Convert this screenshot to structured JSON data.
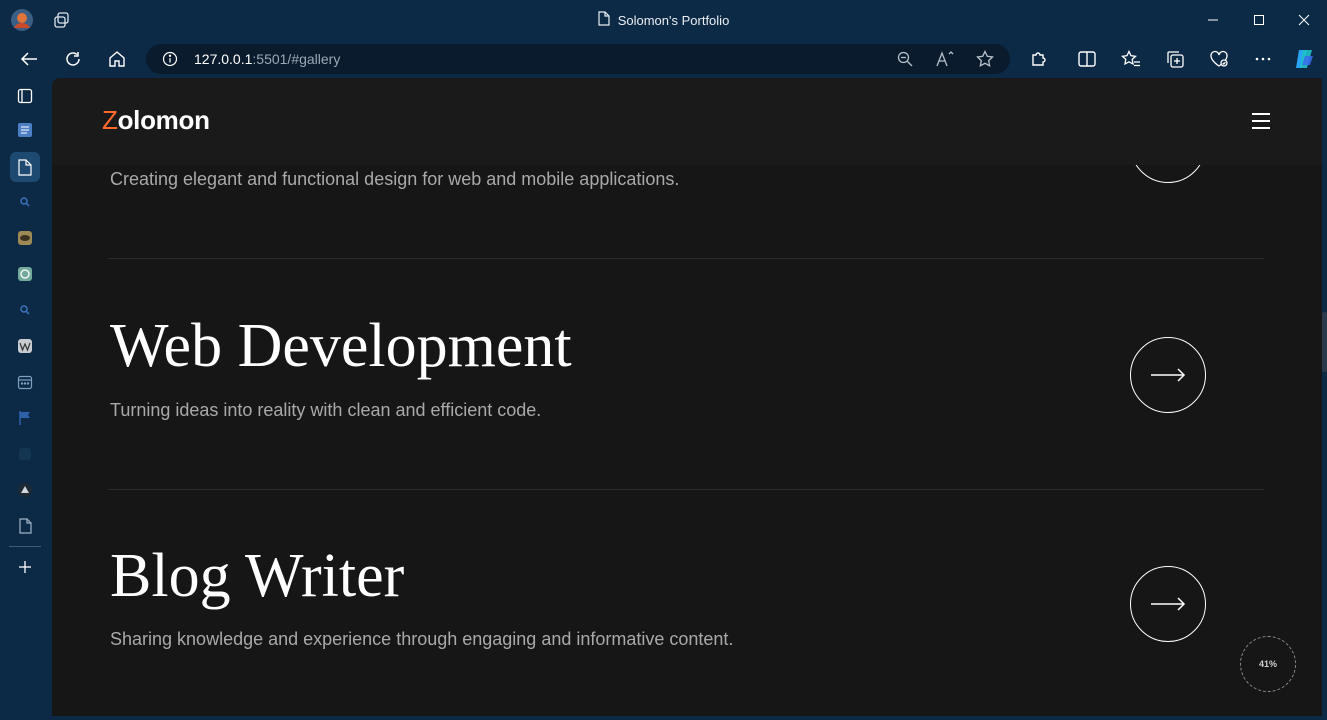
{
  "browser": {
    "window_title": "Solomon's Portfolio",
    "url_host": "127.0.0.1",
    "url_rest": ":5501/#gallery"
  },
  "colors": {
    "accent": "#ff6a2b",
    "page_bg": "#161616",
    "header_bg": "#1a1a1a",
    "browser_chrome": "#0c2a45"
  },
  "site": {
    "logo_initial": "Z",
    "logo_rest": "olomon"
  },
  "services": [
    {
      "title": "",
      "description": "Creating elegant and functional design for web and mobile applications."
    },
    {
      "title": "Web Development",
      "description": "Turning ideas into reality with clean and efficient code."
    },
    {
      "title": "Blog Writer",
      "description": "Sharing knowledge and experience through engaging and informative content."
    }
  ],
  "scroll_progress": {
    "label": "41%",
    "value": 0.41
  },
  "icons": {
    "titlebar": [
      "profile-avatar-icon",
      "workspaces-icon",
      "document-icon"
    ],
    "toolbar": [
      "back-icon",
      "refresh-icon",
      "home-icon",
      "info-icon",
      "zoom-out-icon",
      "read-aloud-icon",
      "favorite-star-icon",
      "extensions-icon",
      "split-screen-icon",
      "favorites-icon",
      "collections-icon",
      "browser-essentials-icon",
      "more-icon",
      "copilot-icon"
    ],
    "sidebar": [
      "tab-actions-icon",
      "reading-list-icon",
      "page-icon",
      "search-icon",
      "app-icon",
      "chatgpt-icon",
      "search-icon",
      "wikipedia-icon",
      "calendar-icon",
      "flag-icon",
      "app-icon",
      "drive-icon",
      "document-icon",
      "add-icon"
    ]
  }
}
